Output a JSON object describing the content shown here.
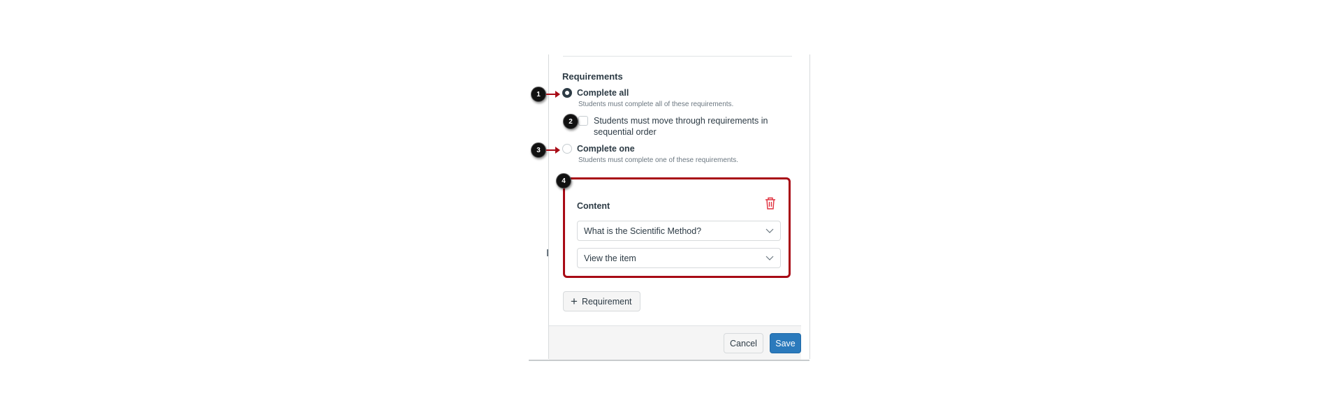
{
  "requirements": {
    "title": "Requirements",
    "options": [
      {
        "label": "Complete all",
        "description": "Students must complete all of these requirements.",
        "selected": true
      },
      {
        "label": "Complete one",
        "description": "Students must complete one of these requirements.",
        "selected": false
      }
    ],
    "sequential_checkbox": {
      "label": "Students must move through requirements in sequential order",
      "checked": false
    }
  },
  "content_card": {
    "title": "Content",
    "delete_icon": "trash-icon",
    "item_select": {
      "value": "What is the Scientific Method?"
    },
    "action_select": {
      "value": "View the item"
    }
  },
  "add_requirement_button": {
    "label": "Requirement",
    "icon": "plus-icon"
  },
  "footer": {
    "cancel_label": "Cancel",
    "save_label": "Save"
  },
  "callouts": [
    "1",
    "2",
    "3",
    "4"
  ],
  "colors": {
    "accent_red": "#a80b16",
    "primary_blue": "#2b7abc",
    "text": "#2d3b45",
    "muted": "#6b7780"
  }
}
